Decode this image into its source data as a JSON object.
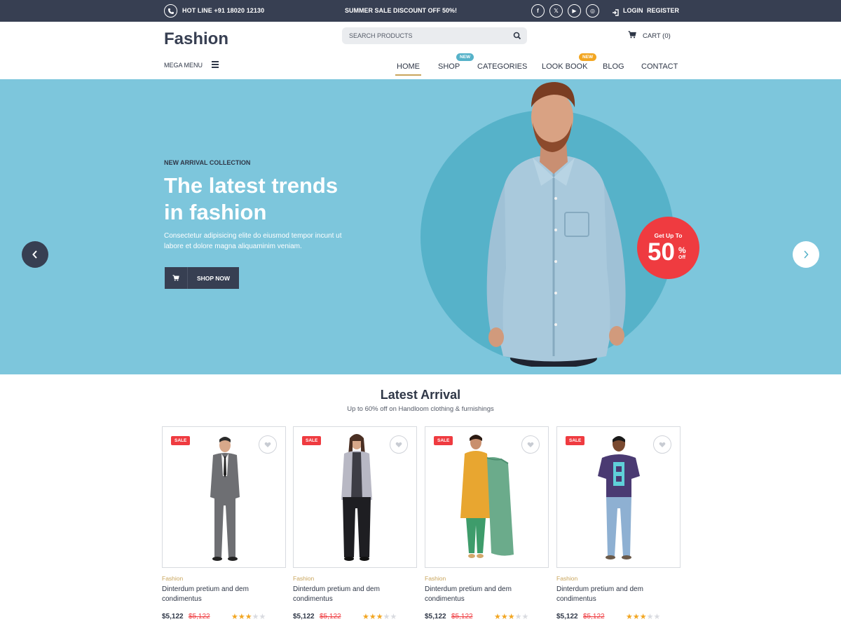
{
  "topbar": {
    "hotline": "HOT LINE +91 18020 12130",
    "promo": "SUMMER SALE DISCOUNT OFF 50%!",
    "social_icons": [
      "facebook-icon",
      "x-icon",
      "youtube-icon",
      "instagram-icon"
    ],
    "social_glyphs": [
      "f",
      "𝕏",
      "▶",
      "◎"
    ],
    "login": "LOGIN",
    "register": "REGISTER"
  },
  "header": {
    "logo": "Fashion",
    "mega_menu": "MEGA MENU",
    "search_placeholder": "SEARCH PRODUCTS",
    "cart": "CART (0)",
    "nav": [
      {
        "label": "HOME",
        "active": true
      },
      {
        "label": "SHOP",
        "badge": "NEW"
      },
      {
        "label": "CATEGORIES"
      },
      {
        "label": "LOOK BOOK",
        "badge": "NEW"
      },
      {
        "label": "BLOG"
      },
      {
        "label": "CONTACT"
      }
    ]
  },
  "hero": {
    "eyebrow": "NEW ARRIVAL COLLECTION",
    "headline_line1": "The latest trends",
    "headline_line2": "in fashion",
    "description": "Consectetur adipisicing elite do eiusmod tempor incunt ut labore et dolore magna aliquaminim veniam.",
    "button": "SHOP NOW",
    "offer_top": "Get Up To",
    "offer_number": "50",
    "offer_percent": "%",
    "offer_off": "Off"
  },
  "latest": {
    "title": "Latest Arrival",
    "subtitle": "Up to 60% off on Handloom clothing & furnishings",
    "products": [
      {
        "badge": "SALE",
        "category": "Fashion",
        "name": "Dinterdum pretium and dem condimentus",
        "price": "$5,122",
        "old_price": "$5,122",
        "rating": 3
      },
      {
        "badge": "SALE",
        "category": "Fashion",
        "name": "Dinterdum pretium and dem condimentus",
        "price": "$5,122",
        "old_price": "$5,122",
        "rating": 3
      },
      {
        "badge": "SALE",
        "category": "Fashion",
        "name": "Dinterdum pretium and dem condimentus",
        "price": "$5,122",
        "old_price": "$5,122",
        "rating": 3
      },
      {
        "badge": "SALE",
        "category": "Fashion",
        "name": "Dinterdum pretium and dem condimentus",
        "price": "$5,122",
        "old_price": "$5,122",
        "rating": 3
      }
    ]
  },
  "colors": {
    "dark": "#373f52",
    "hero_bg": "#7dc6dc",
    "circle": "#56b2c9",
    "offer_red": "#ef3b40",
    "gold": "#c9a55c",
    "badge_teal": "#56b2c9",
    "badge_orange": "#f2a622"
  }
}
